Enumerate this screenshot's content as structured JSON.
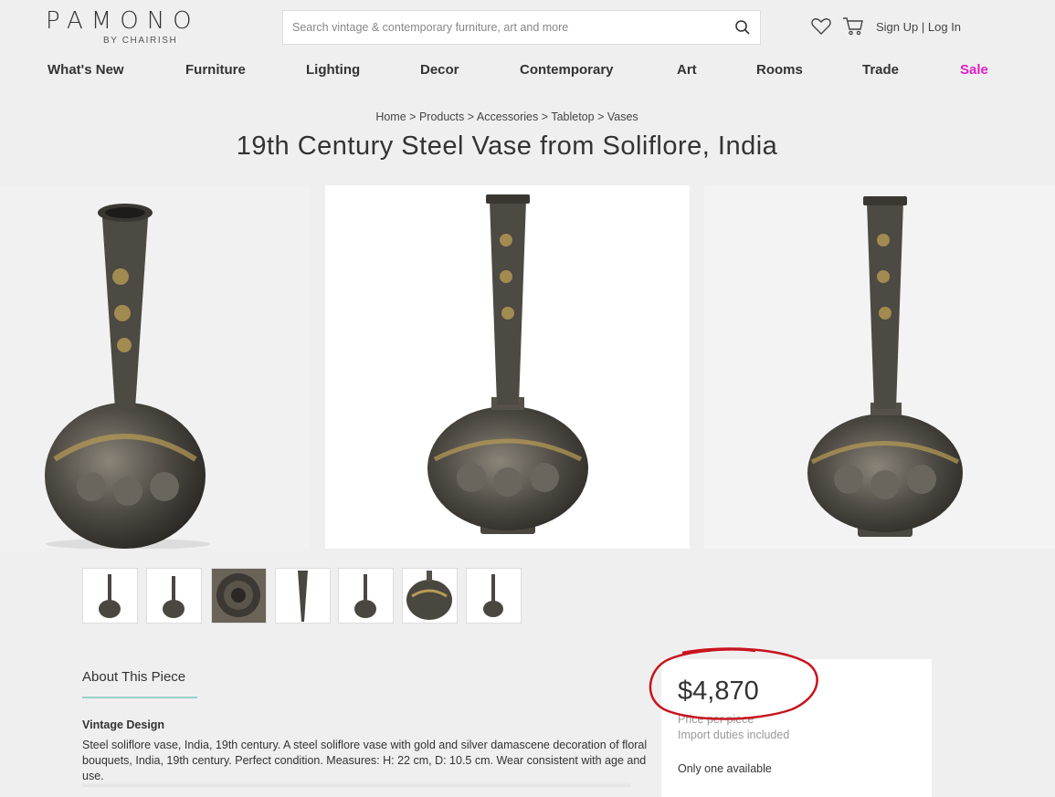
{
  "header": {
    "logo_text": "PAMONO",
    "logo_subtitle": "BY CHAIRISH",
    "search_placeholder": "Search vintage & contemporary furniture, art and more",
    "search_icon": "search-icon",
    "wishlist_icon": "heart-icon",
    "cart_icon": "cart-icon",
    "sign_up": "Sign Up",
    "separator": "|",
    "log_in": "Log In"
  },
  "nav": {
    "items": [
      "What's New",
      "Furniture",
      "Lighting",
      "Decor",
      "Contemporary",
      "Art",
      "Rooms",
      "Trade",
      "Sale"
    ],
    "sale_color": "#e01fc8"
  },
  "breadcrumb": {
    "items": [
      "Home",
      "Products",
      "Accessories",
      "Tabletop",
      "Vases"
    ],
    "separator": ">"
  },
  "product": {
    "title": "19th Century Steel Vase from Soliflore, India",
    "main_image_count": 3,
    "thumbnail_count": 7
  },
  "about": {
    "heading": "About This Piece",
    "accent_color": "#9bcfcb",
    "subheading": "Vintage Design",
    "description": "Steel soliflore vase, India, 19th century. A steel soliflore vase with gold and silver damascene decoration of floral bouquets, India, 19th century. Perfect condition. Measures: H: 22 cm, D: 10.5 cm. Wear consistent with age and use."
  },
  "purchase": {
    "price": "$4,870",
    "price_note": "Price per piece",
    "duties": "Import duties included",
    "availability": "Only one available",
    "annotation_color": "#c8141e"
  }
}
